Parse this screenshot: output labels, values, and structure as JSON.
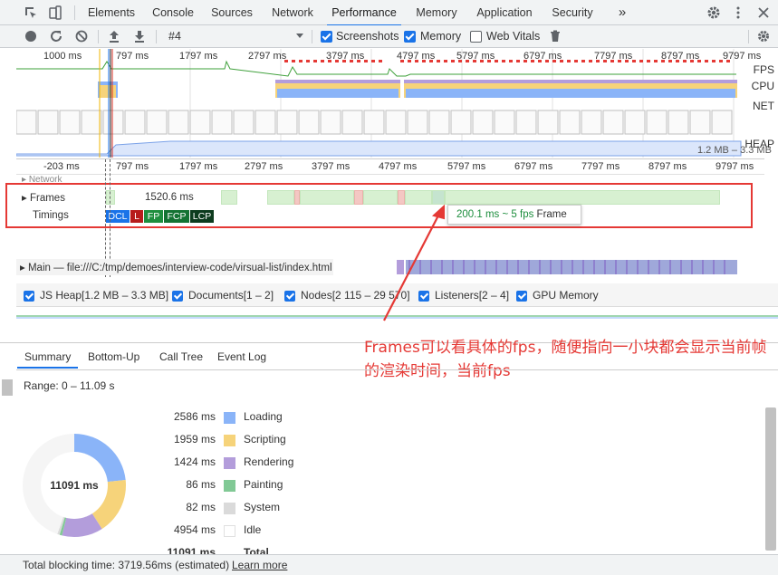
{
  "tabs": [
    "Elements",
    "Console",
    "Sources",
    "Network",
    "Performance",
    "Memory",
    "Application",
    "Security"
  ],
  "more_tabs": "»",
  "toolbar": {
    "profile": "#4",
    "screenshots": "Screenshots",
    "memory": "Memory",
    "web_vitals": "Web Vitals"
  },
  "overview": {
    "ticks": [
      "1000 ms",
      "797 ms",
      "1797 ms",
      "2797 ms",
      "3797 ms",
      "4797 ms",
      "5797 ms",
      "6797 ms",
      "7797 ms",
      "8797 ms",
      "9797 ms"
    ],
    "labels": {
      "fps": "FPS",
      "cpu": "CPU",
      "net": "NET",
      "heap": "HEAP"
    },
    "heap_range": "1.2 MB – 3.3 MB"
  },
  "ruler": [
    "-203 ms",
    "797 ms",
    "1797 ms",
    "2797 ms",
    "3797 ms",
    "4797 ms",
    "5797 ms",
    "6797 ms",
    "7797 ms",
    "8797 ms",
    "9797 ms"
  ],
  "tracks": {
    "network": "Network",
    "frames": "Frames",
    "frame_duration": "1520.6 ms",
    "timings": "Timings",
    "badges": [
      {
        "text": "DCL",
        "color": "#1a73e8"
      },
      {
        "text": "L",
        "color": "#b71c1c"
      },
      {
        "text": "FP",
        "color": "#1e8e3e"
      },
      {
        "text": "FCP",
        "color": "#137333"
      },
      {
        "text": "LCP",
        "color": "#0d3b1e"
      }
    ],
    "main": "Main — file:///C:/tmp/demoes/interview-code/virsual-list/index.html"
  },
  "tooltip": {
    "fps": "200.1 ms ~ 5 fps",
    "label": "Frame"
  },
  "counters": [
    {
      "label": "JS Heap[1.2 MB – 3.3 MB]",
      "color": "#8ab4f8"
    },
    {
      "label": "Documents[1 – 2]",
      "color": "#e57373"
    },
    {
      "label": "Nodes[2 115 – 29 570]",
      "color": "#81c995"
    },
    {
      "label": "Listeners[2 – 4]",
      "color": "#e8b86d"
    },
    {
      "label": "GPU Memory",
      "color": "#d97be0"
    }
  ],
  "annotation": "Frames可以看具体的fps，随便指向一小块都会显示当前帧的渲染时间，当前fps",
  "bottom_tabs": [
    "Summary",
    "Bottom-Up",
    "Call Tree",
    "Event Log"
  ],
  "range": "Range: 0 – 11.09 s",
  "summary": {
    "total_center": "11091 ms",
    "rows": [
      {
        "ms": "2586 ms",
        "name": "Loading",
        "color": "#8ab4f8",
        "value": 2586
      },
      {
        "ms": "1959 ms",
        "name": "Scripting",
        "color": "#f6d37a",
        "value": 1959
      },
      {
        "ms": "1424 ms",
        "name": "Rendering",
        "color": "#b39ddb",
        "value": 1424
      },
      {
        "ms": "86 ms",
        "name": "Painting",
        "color": "#81c995",
        "value": 86
      },
      {
        "ms": "82 ms",
        "name": "System",
        "color": "#dadada",
        "value": 82
      },
      {
        "ms": "4954 ms",
        "name": "Idle",
        "color": "#f5f5f5",
        "value": 4954
      }
    ],
    "total_ms": "11091 ms",
    "total_label": "Total"
  },
  "footer": {
    "text": "Total blocking time: 3719.56ms (estimated)",
    "link": "Learn more"
  }
}
